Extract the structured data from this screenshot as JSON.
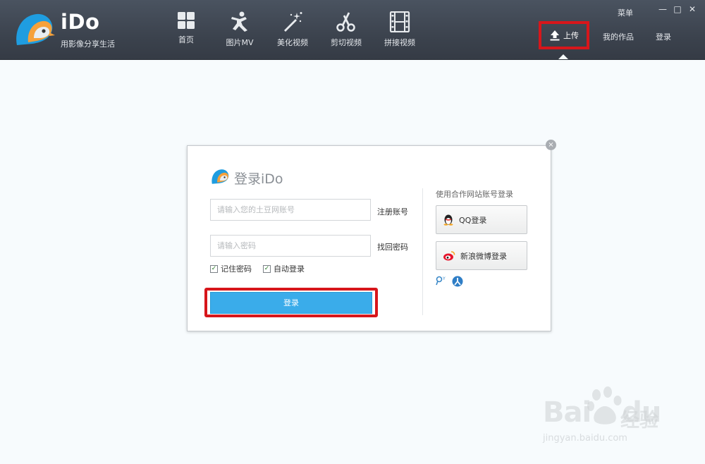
{
  "brand": {
    "name": "iDo",
    "slogan": "用影像分享生活"
  },
  "nav": [
    {
      "label": "首页",
      "icon": "grid-icon"
    },
    {
      "label": "图片MV",
      "icon": "dancer-icon"
    },
    {
      "label": "美化视频",
      "icon": "magic-wand-icon"
    },
    {
      "label": "剪切视频",
      "icon": "scissors-icon"
    },
    {
      "label": "拼接视频",
      "icon": "film-strip-icon"
    }
  ],
  "window": {
    "menu": "菜单",
    "minimize": "—",
    "maximize": "□",
    "close": "✕"
  },
  "top_actions": {
    "upload": "上传",
    "my_works": "我的作品",
    "login": "登录"
  },
  "dialog": {
    "title": "登录iDo",
    "close": "×",
    "username_placeholder": "请输入您的土豆网账号",
    "username_value": "",
    "register_link": "注册账号",
    "password_placeholder": "请输入密码",
    "password_value": "",
    "forgot_link": "找回密码",
    "remember_label": "记住密码",
    "remember_checked": true,
    "autologin_label": "自动登录",
    "autologin_checked": true,
    "login_button": "登录",
    "partner_title": "使用合作网站账号登录",
    "qq_button": "QQ登录",
    "weibo_button": "新浪微博登录",
    "extra_icons": [
      "pengyou-icon",
      "renren-icon"
    ]
  },
  "watermark": {
    "text": "Bai",
    "text2": "du",
    "cn": "经验",
    "url": "jingyan.baidu.com"
  },
  "colors": {
    "topbar": "#3c434e",
    "accent": "#3aacea",
    "highlight": "#d7161b"
  }
}
